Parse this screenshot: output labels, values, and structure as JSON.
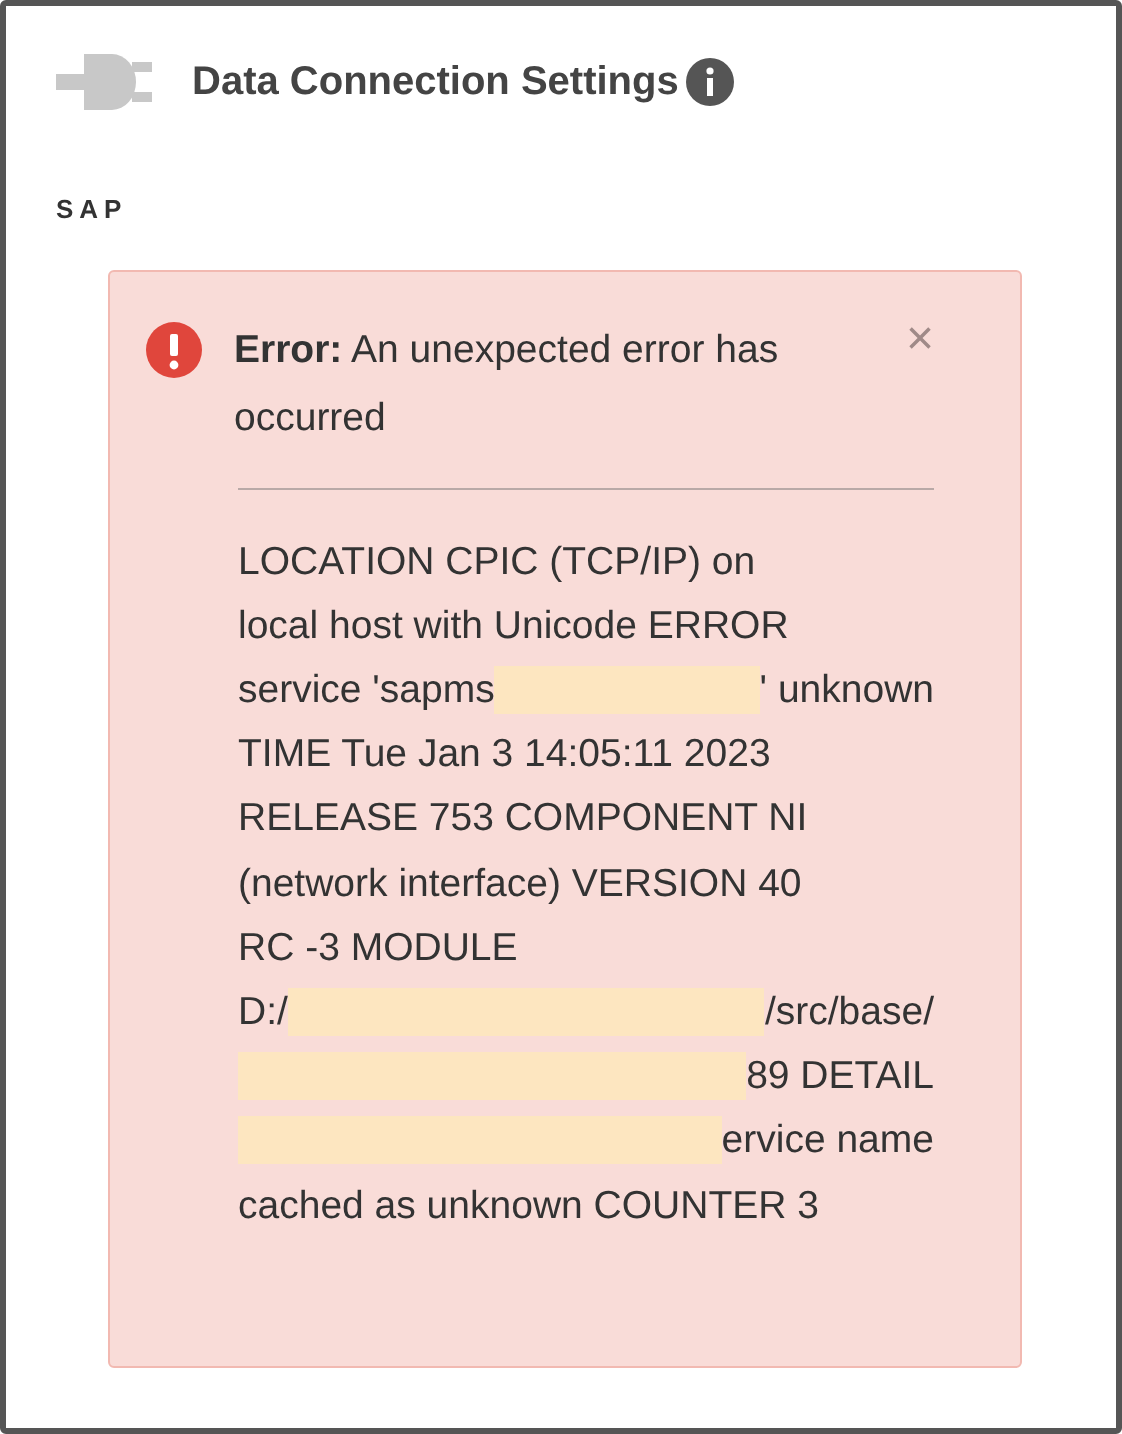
{
  "header": {
    "title": "Data Connection Settings"
  },
  "section": {
    "label": "SAP"
  },
  "alert": {
    "label": "Error:",
    "message": "An unexpected error has occurred",
    "close_button": "×",
    "detail_lines": [
      [
        {
          "kind": "text",
          "text": "LOCATION CPIC (TCP/IP) on"
        }
      ],
      [
        {
          "kind": "text",
          "text": "local host with Unicode ERROR"
        }
      ],
      [
        {
          "kind": "text",
          "text": "service 'sapms"
        },
        {
          "kind": "redacted"
        },
        {
          "kind": "text",
          "text": "' unknown"
        }
      ],
      [
        {
          "kind": "text",
          "text": "TIME Tue Jan 3 14:05:11 2023"
        }
      ],
      [
        {
          "kind": "text",
          "text": "RELEASE 753 COMPONENT NI"
        }
      ],
      [
        {
          "kind": "text",
          "text": "(network interface) VERSION 40"
        }
      ],
      [
        {
          "kind": "text",
          "text": "RC -3 MODULE"
        }
      ],
      [
        {
          "kind": "text",
          "text": "D:/"
        },
        {
          "kind": "redacted"
        },
        {
          "kind": "text",
          "text": "/src/base/"
        }
      ],
      [
        {
          "kind": "redacted"
        },
        {
          "kind": "text",
          "text": "89 DETAIL"
        }
      ],
      [
        {
          "kind": "redacted"
        },
        {
          "kind": "text",
          "text": "ervice name"
        }
      ],
      [
        {
          "kind": "text",
          "text": "cached as unknown COUNTER 3"
        }
      ]
    ]
  }
}
